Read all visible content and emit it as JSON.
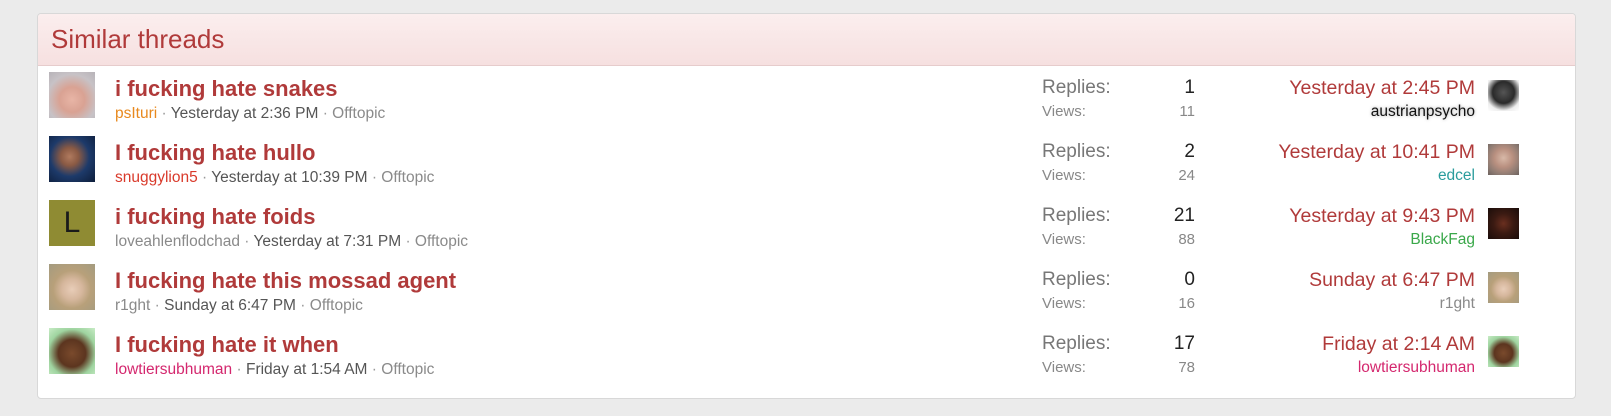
{
  "header": {
    "title": "Similar threads"
  },
  "labels": {
    "replies": "Replies:",
    "views": "Views:",
    "sep": "·"
  },
  "threads": [
    {
      "title": "i fucking hate snakes",
      "author": "psIturi",
      "author_color": "#e8891e",
      "date": "Yesterday at 2:36 PM",
      "forum": "Offtopic",
      "replies": "1",
      "views": "11",
      "last_date": "Yesterday at 2:45 PM",
      "last_user": "austrianpsycho",
      "last_user_color": "#111111",
      "avatar": "photo-avatar",
      "last_avatar": "photo-avatar"
    },
    {
      "title": "I fucking hate hullo",
      "author": "snuggylion5",
      "author_color": "#d93a2b",
      "date": "Yesterday at 10:39 PM",
      "forum": "Offtopic",
      "replies": "2",
      "views": "24",
      "last_date": "Yesterday at 10:41 PM",
      "last_user": "edcel",
      "last_user_color": "#2a9c9c",
      "avatar": "photo-avatar",
      "last_avatar": "photo-avatar"
    },
    {
      "title": "i fucking hate foids",
      "author": "loveahlenflodchad",
      "author_color": "#8a8a8a",
      "date": "Yesterday at 7:31 PM",
      "forum": "Offtopic",
      "replies": "21",
      "views": "88",
      "last_date": "Yesterday at 9:43 PM",
      "last_user": "BlackFag",
      "last_user_color": "#3aa84a",
      "avatar_letter": "L",
      "avatar": "letter-avatar",
      "last_avatar": "photo-avatar"
    },
    {
      "title": "I fucking hate this mossad agent",
      "author": "r1ght",
      "author_color": "#8a8a8a",
      "date": "Sunday at 6:47 PM",
      "forum": "Offtopic",
      "replies": "0",
      "views": "16",
      "last_date": "Sunday at 6:47 PM",
      "last_user": "r1ght",
      "last_user_color": "#8a8a8a",
      "avatar": "photo-avatar",
      "last_avatar": "photo-avatar"
    },
    {
      "title": "I fucking hate it when",
      "author": "lowtiersubhuman",
      "author_color": "#d4276e",
      "date": "Friday at 1:54 AM",
      "forum": "Offtopic",
      "replies": "17",
      "views": "78",
      "last_date": "Friday at 2:14 AM",
      "last_user": "lowtiersubhuman",
      "last_user_color": "#d4276e",
      "avatar": "photo-avatar",
      "last_avatar": "photo-avatar"
    }
  ]
}
